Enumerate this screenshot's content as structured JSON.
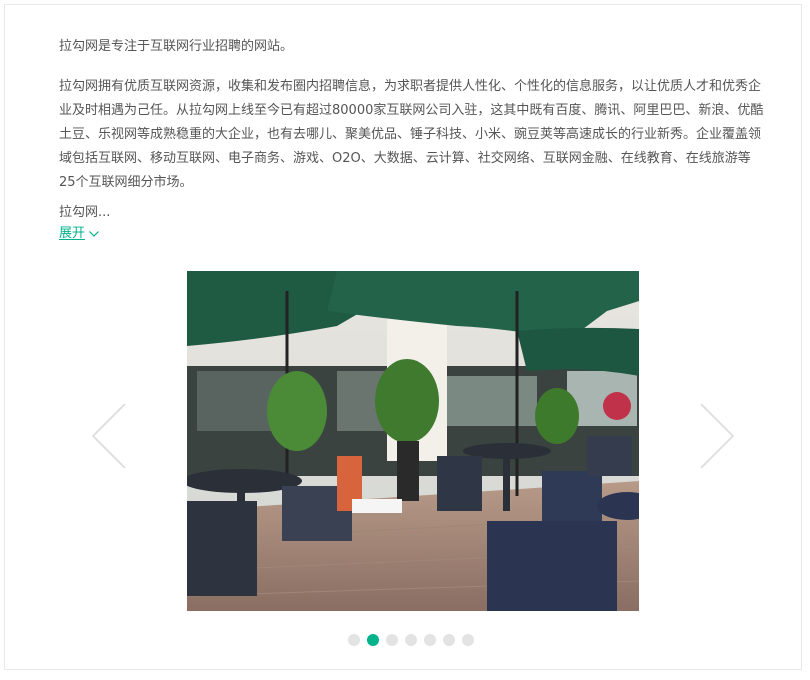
{
  "company_intro": {
    "line1": "拉勾网是专注于互联网行业招聘的网站。",
    "paragraph": "拉勾网拥有优质互联网资源，收集和发布圈内招聘信息，为求职者提供人性化、个性化的信息服务，以让优质人才和优秀企业及时相遇为己任。从拉勾网上线至今已有超过80000家互联网公司入驻，这其中既有百度、腾讯、阿里巴巴、新浪、优酷土豆、乐视网等成熟稳重的大企业，也有去哪儿、聚美优品、锤子科技、小米、豌豆荚等高速成长的行业新秀。企业覆盖领域包括互联网、移动互联网、电子商务、游戏、O2O、大数据、云计算、社交网络、互联网金融、在线教育、在线旅游等25个互联网细分市场。",
    "truncated": "拉勾网...",
    "expand_label": "展开"
  },
  "carousel": {
    "prev_icon": "chevron-left-icon",
    "next_icon": "chevron-right-icon",
    "slide_count": 7,
    "active_index": 1
  },
  "colors": {
    "accent": "#00b38a",
    "text": "#555555",
    "dot_inactive": "#e3e3e3"
  }
}
